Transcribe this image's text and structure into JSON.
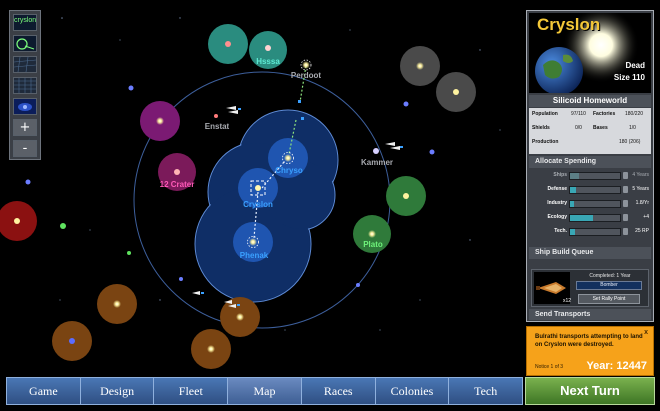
{
  "map": {
    "systems": [
      {
        "name": "Hsssa",
        "color": "#5eead4"
      },
      {
        "name": "Perdoot",
        "color": "#a8aab0"
      },
      {
        "name": "Enstat",
        "color": "#a8aab0"
      },
      {
        "name": "12 Crater",
        "color": "#ff5ab8"
      },
      {
        "name": "Kammer",
        "color": "#a8aab0"
      },
      {
        "name": "Chryso",
        "color": "#3aa0ff"
      },
      {
        "name": "Cryslon",
        "color": "#3aa0ff"
      },
      {
        "name": "Phenak",
        "color": "#3aa0ff"
      },
      {
        "name": "Plato",
        "color": "#6ef27a"
      }
    ]
  },
  "tools": {
    "top_label": "cryslon",
    "zoom_in": "+",
    "zoom_out": "-"
  },
  "planet": {
    "name": "Cryslon",
    "status": "Dead",
    "size": "Size 110",
    "type": "Silicoid Homeworld",
    "stats": {
      "population_label": "Population",
      "population_value": "97/110",
      "factories_label": "Factories",
      "factories_value": "180/220",
      "shields_label": "Shields",
      "shields_value": "0/0",
      "bases_label": "Bases",
      "bases_value": "1/0",
      "production_label": "Production",
      "production_value": "180 (206)"
    }
  },
  "allocate": {
    "title": "Allocate Spending",
    "rows": [
      {
        "label": "Ships",
        "value": "4 Years",
        "fill": 0.18,
        "dim": true
      },
      {
        "label": "Defense",
        "value": "5 Years",
        "fill": 0.12,
        "dim": false
      },
      {
        "label": "Industry",
        "value": "1.8/Yr",
        "fill": 0.08,
        "dim": false
      },
      {
        "label": "Ecology",
        "value": "+4",
        "fill": 0.45,
        "dim": false
      },
      {
        "label": "Tech.",
        "value": "25 RP",
        "fill": 0.1,
        "dim": false
      }
    ]
  },
  "build": {
    "title": "Ship Build Queue",
    "completed": "Completed: 1 Year",
    "design": "Bomber",
    "count": "x12",
    "rally": "Set Rally Point"
  },
  "transports": {
    "label": "Send Transports"
  },
  "notice": {
    "text": "Bulrathi transports attempting to land on Cryslon were destroyed.",
    "count": "Notice 1 of 3",
    "close": "x",
    "year": "Year: 12447"
  },
  "nav": {
    "items": [
      "Game",
      "Design",
      "Fleet",
      "Map",
      "Races",
      "Colonies",
      "Tech"
    ],
    "active": "Map",
    "next_turn": "Next Turn"
  },
  "colors": {
    "nav_blue": "#3a5f96",
    "next_turn_green": "#5a9439",
    "accent_orange": "#f6a21a",
    "player_blue": "#3aa0ff"
  }
}
